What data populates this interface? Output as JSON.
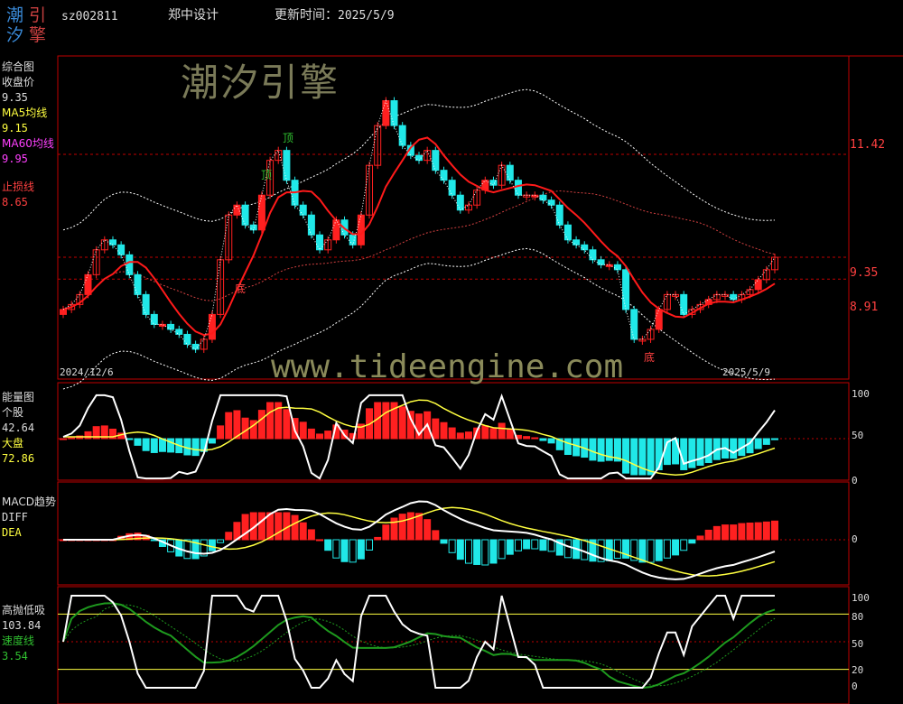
{
  "header": {
    "logo_chars": [
      "潮",
      "引",
      "汐",
      "擎"
    ],
    "stock_code": "sz002811",
    "stock_name": "郑中设计",
    "update_label": "更新时间：",
    "update_time": "2025/5/9"
  },
  "watermarks": {
    "brand": "潮汐引擎",
    "url": "www.tideengine.com"
  },
  "panel_main": {
    "title": "综合图",
    "close_label": "收盘价",
    "close_value": "9.35",
    "ma5_label": "MA5均线",
    "ma5_value": "9.15",
    "ma60_label": "MA60均线",
    "ma60_value": "9.95",
    "stop_label": "止损线",
    "stop_value": "8.65",
    "price_ticks": [
      "11.42",
      "9.35",
      "8.91"
    ],
    "date_start": "2024/12/6",
    "date_end": "2025/5/9",
    "top_mark": "顶",
    "top_mark2": "顶",
    "bottom_mark": "底",
    "bottom_mark2": "底"
  },
  "panel_energy": {
    "title": "能量图",
    "stock_label": "个股",
    "stock_value": "42.64",
    "market_label": "大盘",
    "market_value": "72.86",
    "ticks": [
      "100",
      "50",
      "0"
    ]
  },
  "panel_macd": {
    "title": "MACD趋势",
    "diff_label": "DIFF",
    "dea_label": "DEA",
    "ticks": [
      "0"
    ]
  },
  "panel_kdj": {
    "title": "高抛低吸",
    "value": "103.84",
    "speed_label": "速度线",
    "speed_value": "3.54",
    "ticks": [
      "100",
      "80",
      "50",
      "20",
      "0"
    ]
  },
  "colors": {
    "up": "#ff2020",
    "down": "#20e8e8",
    "grid": "#c00000",
    "ma5": "#ff1a1a",
    "ma60": "#d04040",
    "yellow": "#ffff40",
    "green": "#1e9a1e",
    "white": "#ffffff",
    "label_red": "#ff4040",
    "label_yellow": "#ffff40",
    "label_magenta": "#ff40ff",
    "label_green": "#30c030"
  },
  "chart_data": {
    "type": "candlestick",
    "date_range": [
      "2024/12/6",
      "2025/5/9"
    ],
    "price_levels": [
      11.42,
      9.35,
      8.91
    ],
    "closes": [
      8.3,
      8.4,
      8.6,
      9.0,
      9.5,
      9.7,
      9.6,
      9.4,
      9.0,
      8.6,
      8.2,
      8.0,
      8.0,
      7.9,
      7.8,
      7.6,
      7.5,
      7.7,
      8.2,
      9.3,
      10.2,
      10.4,
      10.0,
      9.9,
      10.6,
      11.3,
      11.5,
      10.9,
      10.4,
      10.2,
      9.8,
      9.5,
      9.7,
      10.1,
      9.8,
      9.6,
      10.2,
      11.2,
      12.0,
      12.5,
      12.0,
      11.6,
      11.4,
      11.3,
      11.5,
      11.1,
      10.9,
      10.6,
      10.3,
      10.4,
      10.7,
      10.9,
      10.8,
      11.2,
      10.9,
      10.6,
      10.6,
      10.6,
      10.5,
      10.4,
      10.0,
      9.7,
      9.6,
      9.5,
      9.3,
      9.2,
      9.2,
      9.1,
      8.3,
      7.7,
      7.7,
      7.9,
      8.3,
      8.6,
      8.6,
      8.2,
      8.3,
      8.4,
      8.5,
      8.6,
      8.6,
      8.5,
      8.6,
      8.7,
      8.9,
      9.1,
      9.35
    ],
    "energy_stock_last": 42.64,
    "energy_market_last": 72.86,
    "kdj_last": 103.84,
    "speed_last": 3.54
  }
}
